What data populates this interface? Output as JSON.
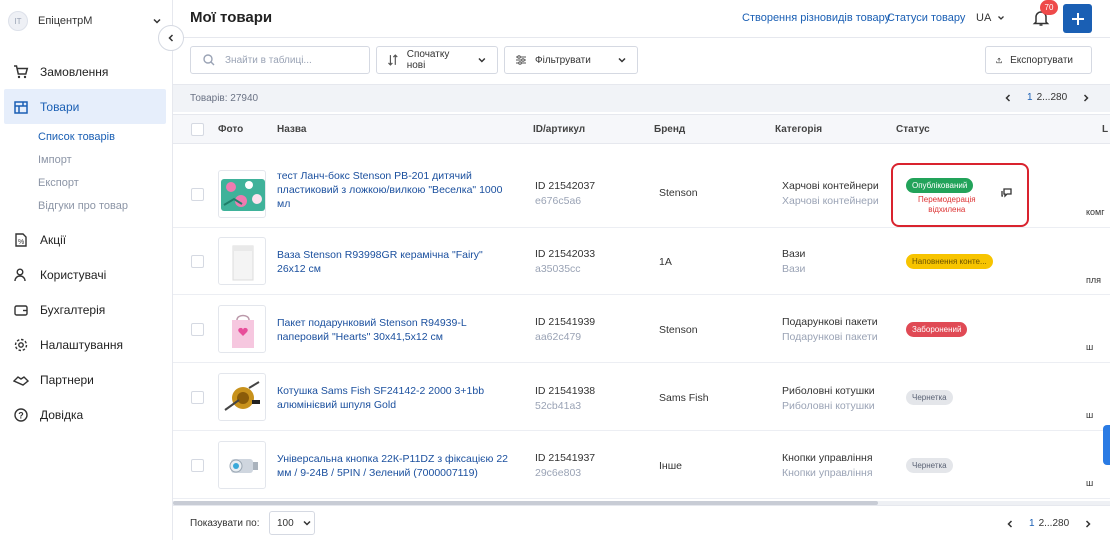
{
  "account": {
    "initials": "IT",
    "name": "ЕпіцентрМ"
  },
  "nav": {
    "items": [
      {
        "label": "Замовлення",
        "icon": "cart-icon"
      },
      {
        "label": "Товари",
        "icon": "store-icon"
      },
      {
        "label": "Акції",
        "icon": "promo-icon"
      },
      {
        "label": "Користувачі",
        "icon": "users-icon"
      },
      {
        "label": "Бухгалтерія",
        "icon": "wallet-icon"
      },
      {
        "label": "Налаштування",
        "icon": "gear-icon"
      },
      {
        "label": "Партнери",
        "icon": "handshake-icon"
      },
      {
        "label": "Довідка",
        "icon": "help-icon"
      }
    ],
    "sub": [
      {
        "label": "Список товарів"
      },
      {
        "label": "Імпорт"
      },
      {
        "label": "Експорт"
      },
      {
        "label": "Відгуки про товар"
      }
    ]
  },
  "header": {
    "title": "Мої товари",
    "link_variants": "Створення різновидів товару",
    "link_statuses": "Статуси товару",
    "lang": "UA",
    "notifications": "70"
  },
  "toolbar": {
    "search_placeholder": "Знайти в таблиці...",
    "sort_label": "Спочатку нові",
    "filter_label": "Фільтрувати",
    "export_label": "Експортувати"
  },
  "info": {
    "count": "Товарів: 27940",
    "page_current": "1",
    "page_rest": "2...280"
  },
  "columns": {
    "photo": "Фото",
    "name": "Назва",
    "id": "ID/артикул",
    "brand": "Бренд",
    "category": "Категорія",
    "status": "Статус",
    "extra": "L"
  },
  "rows": [
    {
      "name": "тест Ланч-бокс Stenson PB-201 дитячий пластиковий з ложкою/вилкою \"Веселка\" 1000 мл",
      "id": "ID 21542037",
      "article": "e676c5a6",
      "brand": "Stenson",
      "category": "Харчові контейнери",
      "category_sub": "Харчові контейнери",
      "status": "Опублікований",
      "note_1": "Перемодерація",
      "note_2": "відхилена",
      "edge": "комг"
    },
    {
      "name": "Ваза Stenson R93998GR керамічна \"Fairy\" 26х12 см",
      "id": "ID 21542033",
      "article": "a35035cc",
      "brand": "1A",
      "category": "Вази",
      "category_sub": "Вази",
      "status": "Наповнення конте...",
      "edge": "пля"
    },
    {
      "name": "Пакет подарунковий Stenson R94939-L паперовий \"Hearts\" 30х41,5х12 см",
      "id": "ID 21541939",
      "article": "aa62c479",
      "brand": "Stenson",
      "category": "Подарункові пакети",
      "category_sub": "Подарункові пакети",
      "status": "Заборонений",
      "edge": "ш"
    },
    {
      "name": "Котушка Sams Fish SF24142-2 2000 3+1bb алюмінієвий шпуля Gold",
      "id": "ID 21541938",
      "article": "52cb41a3",
      "brand": "Sams Fish",
      "category": "Риболовні котушки",
      "category_sub": "Риболовні котушки",
      "status": "Чернетка",
      "edge": "ш"
    },
    {
      "name": "Універсальна кнопка 22К-P11DZ з фіксацією 22 мм / 9-24В / 5PIN / Зелений (7000007119)",
      "id": "ID 21541937",
      "article": "29c6e803",
      "brand": "Інше",
      "category": "Кнопки управління",
      "category_sub": "Кнопки управління",
      "status": "Чернетка",
      "edge": "ш"
    }
  ],
  "footer": {
    "show_label": "Показувати по:",
    "per_page": "100",
    "page_current": "1",
    "page_rest": "2...280"
  },
  "colors": {
    "accent": "#1a5fb4",
    "published": "#22a35a",
    "filling": "#f7c400",
    "banned": "#e04a55",
    "draft": "#e4e6ea",
    "highlight": "#d9232e"
  }
}
